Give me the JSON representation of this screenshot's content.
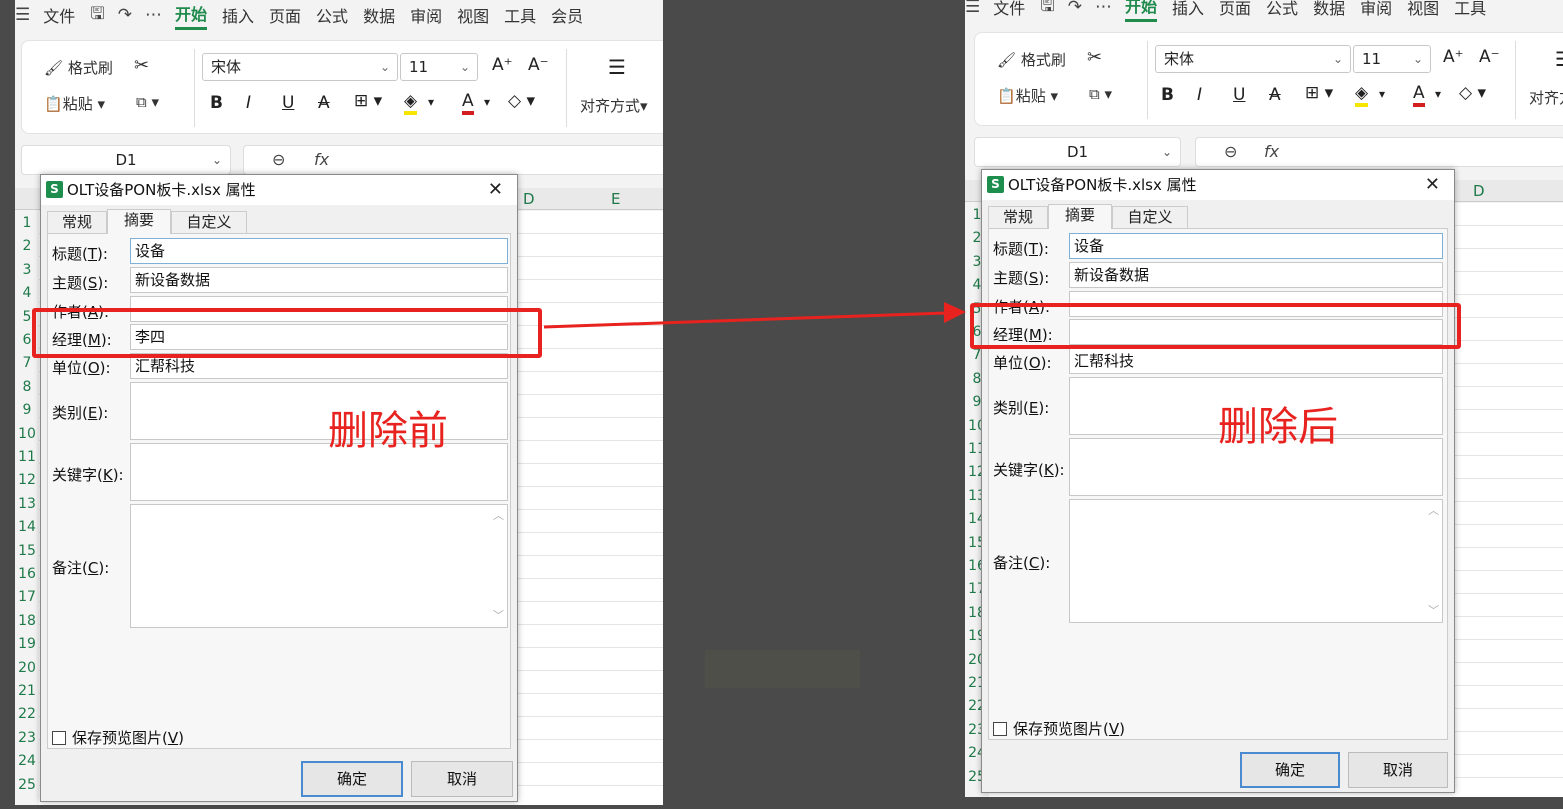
{
  "menu": {
    "hamburger": "☰",
    "file": "文件",
    "tabs": [
      "开始",
      "插入",
      "页面",
      "公式",
      "数据",
      "审阅",
      "视图",
      "工具",
      "会员"
    ],
    "right_tabs": [
      "开始",
      "插入",
      "页面",
      "公式",
      "数据",
      "审阅",
      "视图",
      "工具"
    ]
  },
  "ribbon": {
    "format_painter": "格式刷",
    "paste": "粘贴",
    "font_name": "宋体",
    "font_size": "11",
    "bold": "B",
    "italic": "I",
    "underline": "U",
    "strike": "A",
    "increase_font": "A⁺",
    "decrease_font": "A⁻",
    "align_label": "对齐方式",
    "align_label_cut": "对齐方"
  },
  "formula": {
    "name_box": "D1",
    "fx": "fx"
  },
  "sheet": {
    "cols_left": [
      "D",
      "E"
    ],
    "cols_right": [
      "D"
    ],
    "rows": [
      "1",
      "2",
      "3",
      "4",
      "5",
      "6",
      "7",
      "8",
      "9",
      "10",
      "11",
      "12",
      "13",
      "14",
      "15",
      "16",
      "17",
      "18",
      "19",
      "20",
      "21",
      "22",
      "23",
      "24",
      "25"
    ]
  },
  "dialog": {
    "title": "OLT设备PON板卡.xlsx 属性",
    "close": "✕",
    "tabs": [
      "常规",
      "摘要",
      "自定义"
    ],
    "labels": {
      "title": "标题(",
      "title_k": "T",
      "subject": "主题(",
      "subject_k": "S",
      "author": "作者(",
      "author_k": "A",
      "manager": "经理(",
      "manager_k": "M",
      "company": "单位(",
      "company_k": "O",
      "category": "类别(",
      "category_k": "E",
      "keywords": "关键字(",
      "keywords_k": "K",
      "comments": "备注(",
      "comments_k": "C",
      "end": "):"
    },
    "save_preview": "保存预览图片(",
    "save_preview_k": "V",
    "save_preview_end": ")",
    "ok": "确定",
    "cancel": "取消"
  },
  "before": {
    "title": "设备",
    "subject": "新设备数据",
    "author": "",
    "manager": "李四",
    "company": "汇帮科技",
    "label": "删除前"
  },
  "after": {
    "title": "设备",
    "subject": "新设备数据",
    "author": "",
    "manager": "",
    "company": "汇帮科技",
    "label": "删除后"
  },
  "colors": {
    "accent": "#1f8b4c",
    "annotation": "#e8231f",
    "ok_border": "#4a8ad0"
  }
}
